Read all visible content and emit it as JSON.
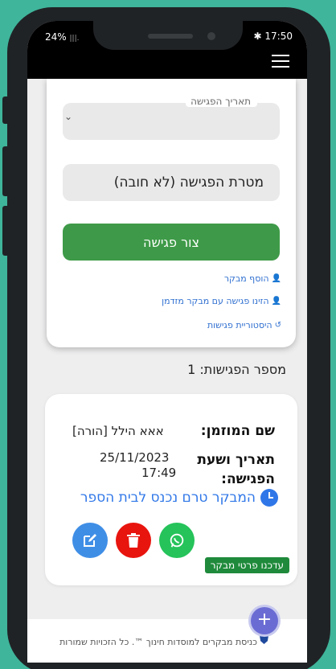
{
  "status_bar": {
    "battery": "24%",
    "signal": "|||.",
    "time": "17:50",
    "bluetooth_icon": "bluetooth-icon"
  },
  "form": {
    "date_label": "תאריך הפגישה",
    "date_value": "",
    "purpose_placeholder": "מטרת הפגישה (לא חובה)",
    "submit_label": "צור פגישה",
    "links": [
      {
        "icon": "user-check-icon",
        "label": "הוסף מבקר"
      },
      {
        "icon": "user-icon",
        "label": "הזינו פגישה עם מבקר מזדמן"
      },
      {
        "icon": "history-icon",
        "label": "היסטוריית פגישות"
      }
    ]
  },
  "meetings": {
    "count_label": "מספר הפגישות: 1",
    "card": {
      "invitee_label": "שם המוזמן:",
      "invitee_value": "אאא הילל [הורה]",
      "datetime_label": "תאריך ושעת הפגישה:",
      "date_value": "25/11/2023",
      "time_value": "17:49",
      "status_text": "המבקר טרם נכנס לבית הספר",
      "update_button": "עדכנו פרטי מבקר"
    }
  },
  "actions": [
    {
      "name": "whatsapp-button",
      "icon": "whatsapp-icon",
      "color": "#25c35a"
    },
    {
      "name": "delete-button",
      "icon": "trash-icon",
      "color": "#e8140e"
    },
    {
      "name": "edit-button",
      "icon": "edit-icon",
      "color": "#3f8ee6"
    }
  ],
  "footer": {
    "text": "כניסת מבקרים למוסדות חינוך ™. כל הזכויות שמורות"
  },
  "fab": {
    "label": "+"
  },
  "colors": {
    "background": "#3fb59b",
    "primary_green": "#3e9a48",
    "link_blue": "#2f6fd0",
    "status_blue": "#2f77e8"
  }
}
